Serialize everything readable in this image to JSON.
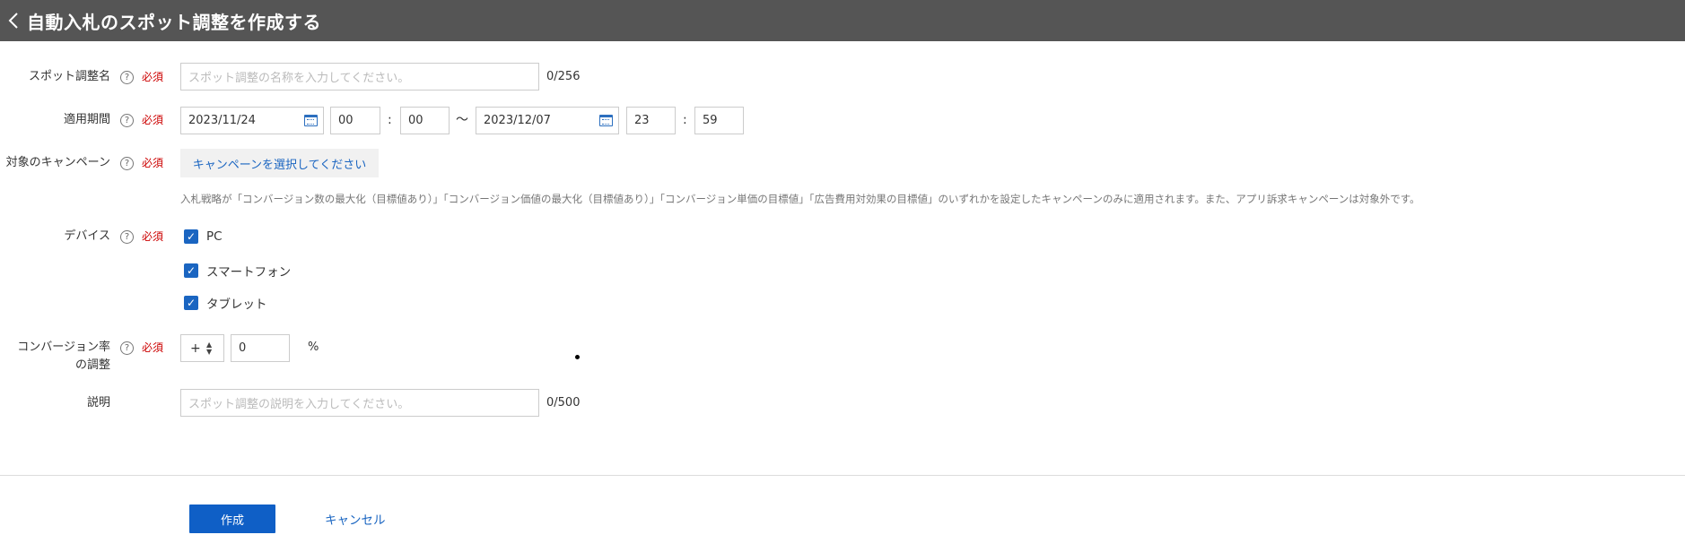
{
  "header": {
    "title": "自動入札のスポット調整を作成する"
  },
  "form": {
    "name": {
      "label": "スポット調整名",
      "required": "必須",
      "placeholder": "スポット調整の名称を入力してください。",
      "counter": "0/256"
    },
    "period": {
      "label": "適用期間",
      "required": "必須",
      "start_date": "2023/11/24",
      "start_hour": "00",
      "start_minute": "00",
      "colon": ":",
      "range_sep": "～",
      "end_date": "2023/12/07",
      "end_hour": "23",
      "end_minute": "59"
    },
    "campaign": {
      "label": "対象のキャンペーン",
      "required": "必須",
      "select_label": "キャンペーンを選択してください",
      "note": "入札戦略が「コンバージョン数の最大化（目標値あり）」「コンバージョン価値の最大化（目標値あり）」「コンバージョン単価の目標値」「広告費用対効果の目標値」のいずれかを設定したキャンペーンのみに適用されます。また、アプリ訴求キャンペーンは対象外です。"
    },
    "device": {
      "label": "デバイス",
      "required": "必須",
      "options": [
        {
          "label": "PC",
          "checked": true
        },
        {
          "label": "スマートフォン",
          "checked": true
        },
        {
          "label": "タブレット",
          "checked": true
        }
      ]
    },
    "conversion": {
      "label_line1": "コンバージョン率",
      "label_line2": "の調整",
      "required": "必須",
      "sign": "+",
      "value": "0",
      "unit": "%"
    },
    "description": {
      "label": "説明",
      "placeholder": "スポット調整の説明を入力してください。",
      "counter": "0/500"
    }
  },
  "actions": {
    "create_label": "作成",
    "cancel_label": "キャンセル"
  },
  "colors": {
    "header_bg": "#555555",
    "accent": "#0f5fc6",
    "required": "#cc0000"
  }
}
